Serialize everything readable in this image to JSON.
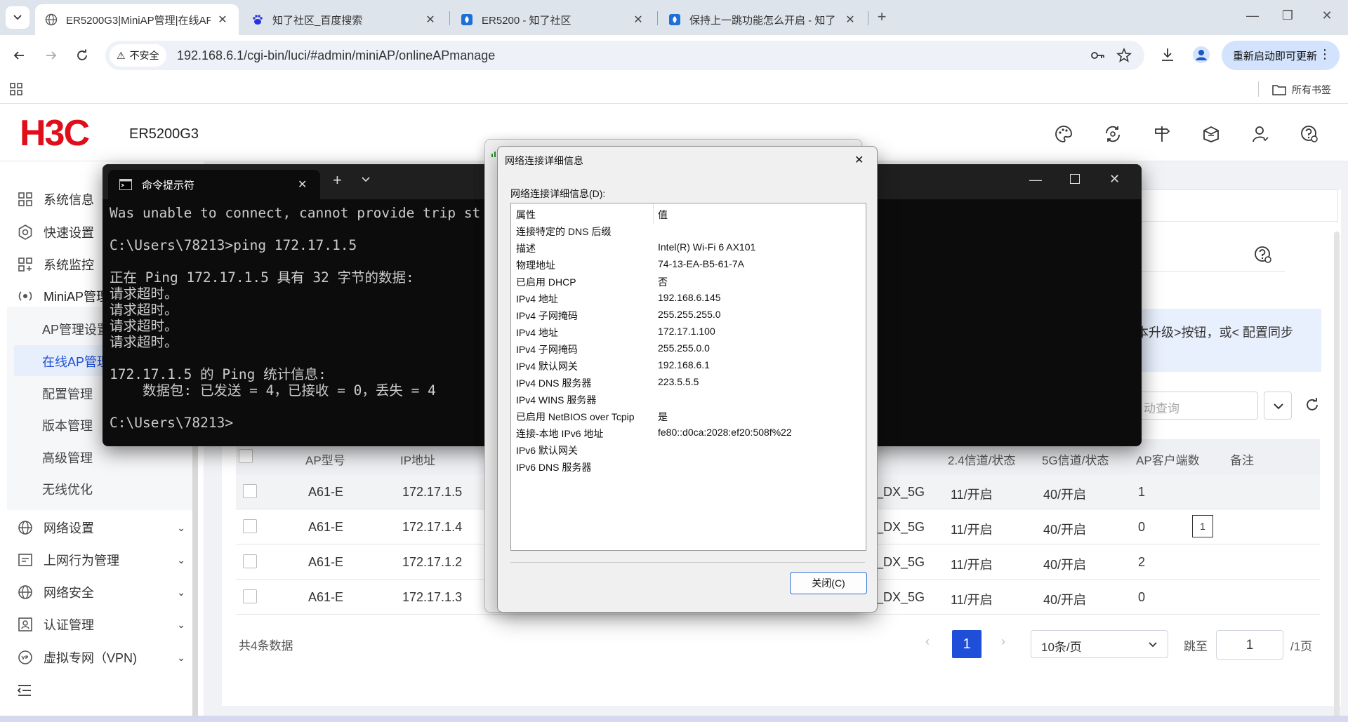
{
  "browser": {
    "tabs": [
      {
        "title": "ER5200G3|MiniAP管理|在线AP",
        "active": true
      },
      {
        "title": "知了社区_百度搜索",
        "active": false
      },
      {
        "title": "ER5200 - 知了社区",
        "active": false
      },
      {
        "title": "保持上一跳功能怎么开启 - 知了",
        "active": false
      }
    ],
    "security_label": "不安全",
    "url": "192.168.6.1/cgi-bin/luci/#admin/miniAP/onlineAPmanage",
    "update_button": "重新启动即可更新",
    "bookmarks_label": "所有书签"
  },
  "app": {
    "logo": "H3C",
    "model": "ER5200G3"
  },
  "sidebar": {
    "items": [
      {
        "label": "系统信息",
        "icon": "dashboard-icon"
      },
      {
        "label": "快速设置",
        "icon": "gear-icon"
      },
      {
        "label": "系统监控",
        "icon": "monitor-icon"
      },
      {
        "label": "MiniAP管理",
        "icon": "ap-icon"
      }
    ],
    "sub_items": [
      "AP管理设置",
      "在线AP管理",
      "配置管理",
      "版本管理",
      "高级管理",
      "无线优化"
    ],
    "more_items": [
      {
        "label": "网络设置",
        "icon": "globe-icon"
      },
      {
        "label": "上网行为管理",
        "icon": "behavior-icon"
      },
      {
        "label": "网络安全",
        "icon": "globe-icon"
      },
      {
        "label": "认证管理",
        "icon": "auth-icon"
      },
      {
        "label": "虚拟专网（VPN)",
        "icon": "vpn-icon"
      }
    ]
  },
  "main": {
    "notice": "本升级>按钮，或< 配置同步",
    "search_placeholder": "动查询",
    "table": {
      "headers": [
        "AP型号",
        "IP地址",
        "2.4信道/状态",
        "5G信道/状态",
        "AP客户端数",
        "备注"
      ],
      "rows": [
        {
          "model": "A61-E",
          "ip": "172.17.1.5",
          "ssid": "r_DX_5G",
          "ch24": "11/开启",
          "ch5": "40/开启",
          "clients": "1",
          "note": ""
        },
        {
          "model": "A61-E",
          "ip": "172.17.1.4",
          "ssid": "r_DX_5G",
          "ch24": "11/开启",
          "ch5": "40/开启",
          "clients": "0",
          "note": "1"
        },
        {
          "model": "A61-E",
          "ip": "172.17.1.2",
          "ssid": "r_DX_5G",
          "ch24": "11/开启",
          "ch5": "40/开启",
          "clients": "2",
          "note": ""
        },
        {
          "model": "A61-E",
          "ip": "172.17.1.3",
          "ssid": "r_DX_5G",
          "ch24": "11/开启",
          "ch5": "40/开启",
          "clients": "0",
          "note": ""
        }
      ]
    },
    "pager": {
      "total": "共4条数据",
      "current_page": "1",
      "page_size": "10条/页",
      "jump_label": "跳至",
      "jump_value": "1",
      "total_pages": "/1页"
    }
  },
  "cmd": {
    "title": "命令提示符",
    "lines": [
      "Was unable to connect, cannot provide trip st",
      "",
      "C:\\Users\\78213>ping 172.17.1.5",
      "",
      "正在 Ping 172.17.1.5 具有 32 字节的数据:",
      "请求超时。",
      "请求超时。",
      "请求超时。",
      "请求超时。",
      "",
      "172.17.1.5 的 Ping 统计信息:",
      "    数据包: 已发送 = 4，已接收 = 0，丢失 = 4",
      "",
      "C:\\Users\\78213>"
    ]
  },
  "dialog": {
    "title": "网络连接详细信息",
    "list_label": "网络连接详细信息(D):",
    "columns": [
      "属性",
      "值"
    ],
    "rows": [
      {
        "k": "连接特定的 DNS 后缀",
        "v": ""
      },
      {
        "k": "描述",
        "v": "Intel(R) Wi-Fi 6 AX101"
      },
      {
        "k": "物理地址",
        "v": "74-13-EA-B5-61-7A"
      },
      {
        "k": "已启用 DHCP",
        "v": "否"
      },
      {
        "k": "IPv4 地址",
        "v": "192.168.6.145"
      },
      {
        "k": "IPv4 子网掩码",
        "v": "255.255.255.0"
      },
      {
        "k": "IPv4 地址",
        "v": "172.17.1.100"
      },
      {
        "k": "IPv4 子网掩码",
        "v": "255.255.0.0"
      },
      {
        "k": "IPv4 默认网关",
        "v": "192.168.6.1"
      },
      {
        "k": "IPv4 DNS 服务器",
        "v": "223.5.5.5"
      },
      {
        "k": "IPv4 WINS 服务器",
        "v": ""
      },
      {
        "k": "已启用 NetBIOS over Tcpip",
        "v": "是"
      },
      {
        "k": "连接-本地 IPv6 地址",
        "v": "fe80::d0ca:2028:ef20:508f%22"
      },
      {
        "k": "IPv6 默认网关",
        "v": ""
      },
      {
        "k": "IPv6 DNS 服务器",
        "v": ""
      }
    ],
    "close_button": "关闭(C)"
  }
}
